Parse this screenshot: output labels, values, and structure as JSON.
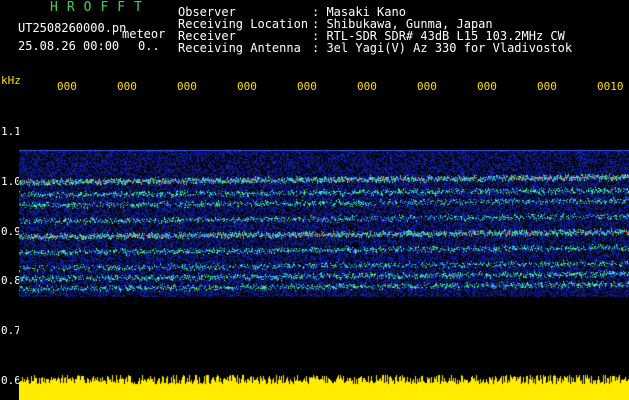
{
  "brand": "HROFFT",
  "file_name": "UT2508260000.pn",
  "meteor_label": "meteor",
  "date_time": "25.08.26 00:00",
  "counter": "0..",
  "meta": [
    {
      "key": "Observer",
      "value": ": Masaki Kano"
    },
    {
      "key": "Receiving Location",
      "value": ": Shibukawa, Gunma, Japan"
    },
    {
      "key": "Receiver",
      "value": ": RTL-SDR SDR# 43dB L15 103.2MHz CW"
    },
    {
      "key": "Receiving Antenna",
      "value": ": 3el Yagi(V) Az 330 for Vladivostok"
    }
  ],
  "colors": {
    "label_green": "#39d353",
    "tick_yellow": "#ffe000",
    "noise_blue": "#1a2aa8",
    "trace_red": "#ff2a2a"
  },
  "chart_data": {
    "type": "heatmap",
    "title": "",
    "ylabel": "kHz",
    "y_ticks": [
      "1.1",
      "1.0",
      "0.9",
      "0.8",
      "0.7",
      "0.6"
    ],
    "x_ticks": [
      "000",
      "000",
      "000",
      "000",
      "000",
      "000",
      "000",
      "000",
      "000",
      "0010"
    ],
    "ylim": [
      0.6,
      1.15
    ],
    "signal_range": [
      0.76,
      1.04
    ],
    "bands": [
      {
        "freq": 0.98,
        "intensity": 0.95
      },
      {
        "freq": 0.955,
        "intensity": 0.55
      },
      {
        "freq": 0.935,
        "intensity": 0.5
      },
      {
        "freq": 0.905,
        "intensity": 0.5
      },
      {
        "freq": 0.875,
        "intensity": 0.95
      },
      {
        "freq": 0.845,
        "intensity": 0.55
      },
      {
        "freq": 0.815,
        "intensity": 0.45
      },
      {
        "freq": 0.795,
        "intensity": 0.6
      },
      {
        "freq": 0.775,
        "intensity": 0.55
      }
    ]
  }
}
